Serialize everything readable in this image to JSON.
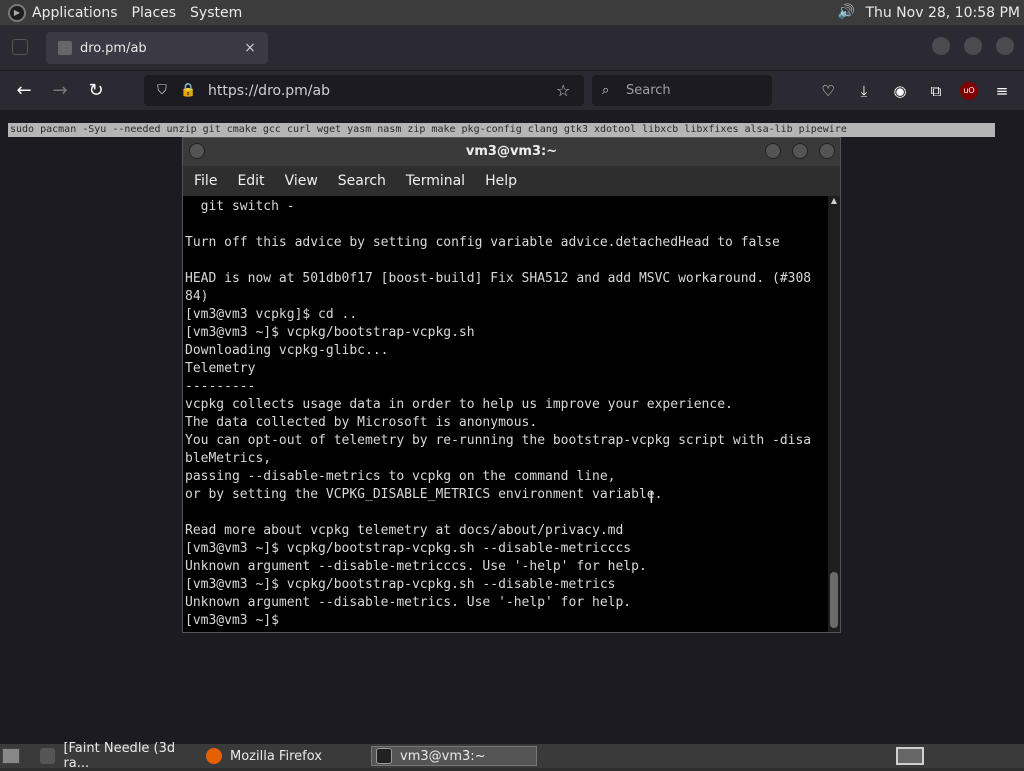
{
  "top_panel": {
    "menus": [
      "Applications",
      "Places",
      "System"
    ],
    "clock": "Thu Nov 28, 10:58 PM"
  },
  "firefox": {
    "tab": {
      "title": "dro.pm/ab",
      "close": "×"
    },
    "url": "https://dro.pm/ab",
    "search_placeholder": "Search",
    "selected_command": "sudo pacman -Syu --needed unzip git cmake gcc curl wget yasm nasm zip make pkg-config clang gtk3 xdotool libxcb libxfixes alsa-lib pipewire"
  },
  "terminal": {
    "title": "vm3@vm3:~",
    "menu": [
      "File",
      "Edit",
      "View",
      "Search",
      "Terminal",
      "Help"
    ],
    "lines": [
      "  git switch -",
      "",
      "Turn off this advice by setting config variable advice.detachedHead to false",
      "",
      "HEAD is now at 501db0f17 [boost-build] Fix SHA512 and add MSVC workaround. (#308",
      "84)",
      "[vm3@vm3 vcpkg]$ cd ..",
      "[vm3@vm3 ~]$ vcpkg/bootstrap-vcpkg.sh",
      "Downloading vcpkg-glibc...",
      "Telemetry",
      "---------",
      "vcpkg collects usage data in order to help us improve your experience.",
      "The data collected by Microsoft is anonymous.",
      "You can opt-out of telemetry by re-running the bootstrap-vcpkg script with -disa",
      "bleMetrics,",
      "passing --disable-metrics to vcpkg on the command line,",
      "or by setting the VCPKG_DISABLE_METRICS environment variable.",
      "",
      "Read more about vcpkg telemetry at docs/about/privacy.md",
      "[vm3@vm3 ~]$ vcpkg/bootstrap-vcpkg.sh --disable-metricccs",
      "Unknown argument --disable-metricccs. Use '-help' for help.",
      "[vm3@vm3 ~]$ vcpkg/bootstrap-vcpkg.sh --disable-metrics",
      "Unknown argument --disable-metrics. Use '-help' for help.",
      "[vm3@vm3 ~]$ "
    ]
  },
  "taskbar": {
    "tasks": [
      "[Faint Needle (3d ra...",
      "Mozilla Firefox",
      "vm3@vm3:~"
    ]
  },
  "colors": {
    "panel": "#3c3c3c",
    "firefox_toolbar": "#2b2a33",
    "terminal_bg": "#000000",
    "terminal_fg": "#d8d8d8"
  }
}
